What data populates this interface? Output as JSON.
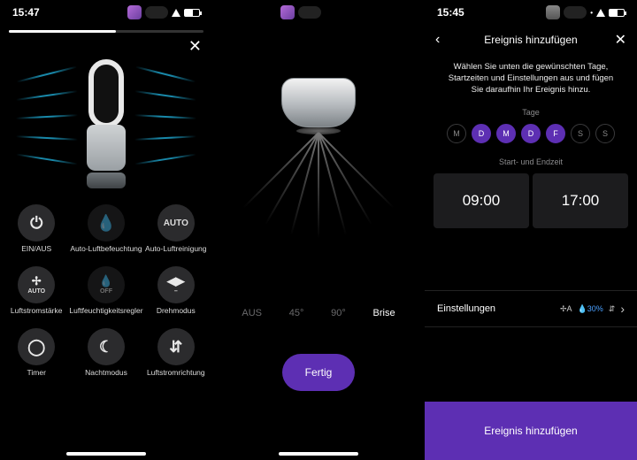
{
  "status": {
    "time_left": "15:47",
    "time_right": "15:45"
  },
  "screen1": {
    "controls": [
      {
        "label": "EIN/AUS",
        "sub": "",
        "glyph": "⏻",
        "text": ""
      },
      {
        "label": "Auto-Luftbefeuchtung",
        "sub": "",
        "glyph": "💧",
        "dim": true
      },
      {
        "label": "Auto-Luftreinigung",
        "sub": "",
        "text": "AUTO"
      },
      {
        "label": "Luftstromstärke",
        "sub": "AUTO",
        "glyph": "✢"
      },
      {
        "label": "Luftfeuchtigkeitsregler",
        "sub": "OFF",
        "glyph": "💧",
        "dim": true
      },
      {
        "label": "Drehmodus",
        "sub": "–",
        "glyph": "◀▶"
      },
      {
        "label": "Timer",
        "sub": "",
        "glyph": "◯"
      },
      {
        "label": "Nachtmodus",
        "sub": "",
        "glyph": "☾"
      },
      {
        "label": "Luftstromrichtung",
        "sub": "",
        "glyph": "⇵"
      }
    ]
  },
  "screen2": {
    "options": [
      {
        "label": "AUS",
        "active": false
      },
      {
        "label": "45°",
        "active": false
      },
      {
        "label": "90°",
        "active": false
      },
      {
        "label": "Brise",
        "active": true
      }
    ],
    "done": "Fertig"
  },
  "screen3": {
    "header": "Ereignis hinzufügen",
    "subtitle": "Wählen Sie unten die gewünschten Tage, Startzeiten und Einstellungen aus und fügen Sie daraufhin Ihr Ereignis hinzu.",
    "days_label": "Tage",
    "times_label": "Start- und Endzeit",
    "days": [
      {
        "abbr": "M",
        "on": false
      },
      {
        "abbr": "D",
        "on": true
      },
      {
        "abbr": "M",
        "on": true
      },
      {
        "abbr": "D",
        "on": true
      },
      {
        "abbr": "F",
        "on": true
      },
      {
        "abbr": "S",
        "on": false
      },
      {
        "abbr": "S",
        "on": false
      }
    ],
    "start": "09:00",
    "end": "17:00",
    "settings_label": "Einstellungen",
    "settings_summary": {
      "mode": "✢A",
      "humid": "💧30%",
      "dir": "⇵"
    },
    "add": "Ereignis hinzufügen"
  }
}
